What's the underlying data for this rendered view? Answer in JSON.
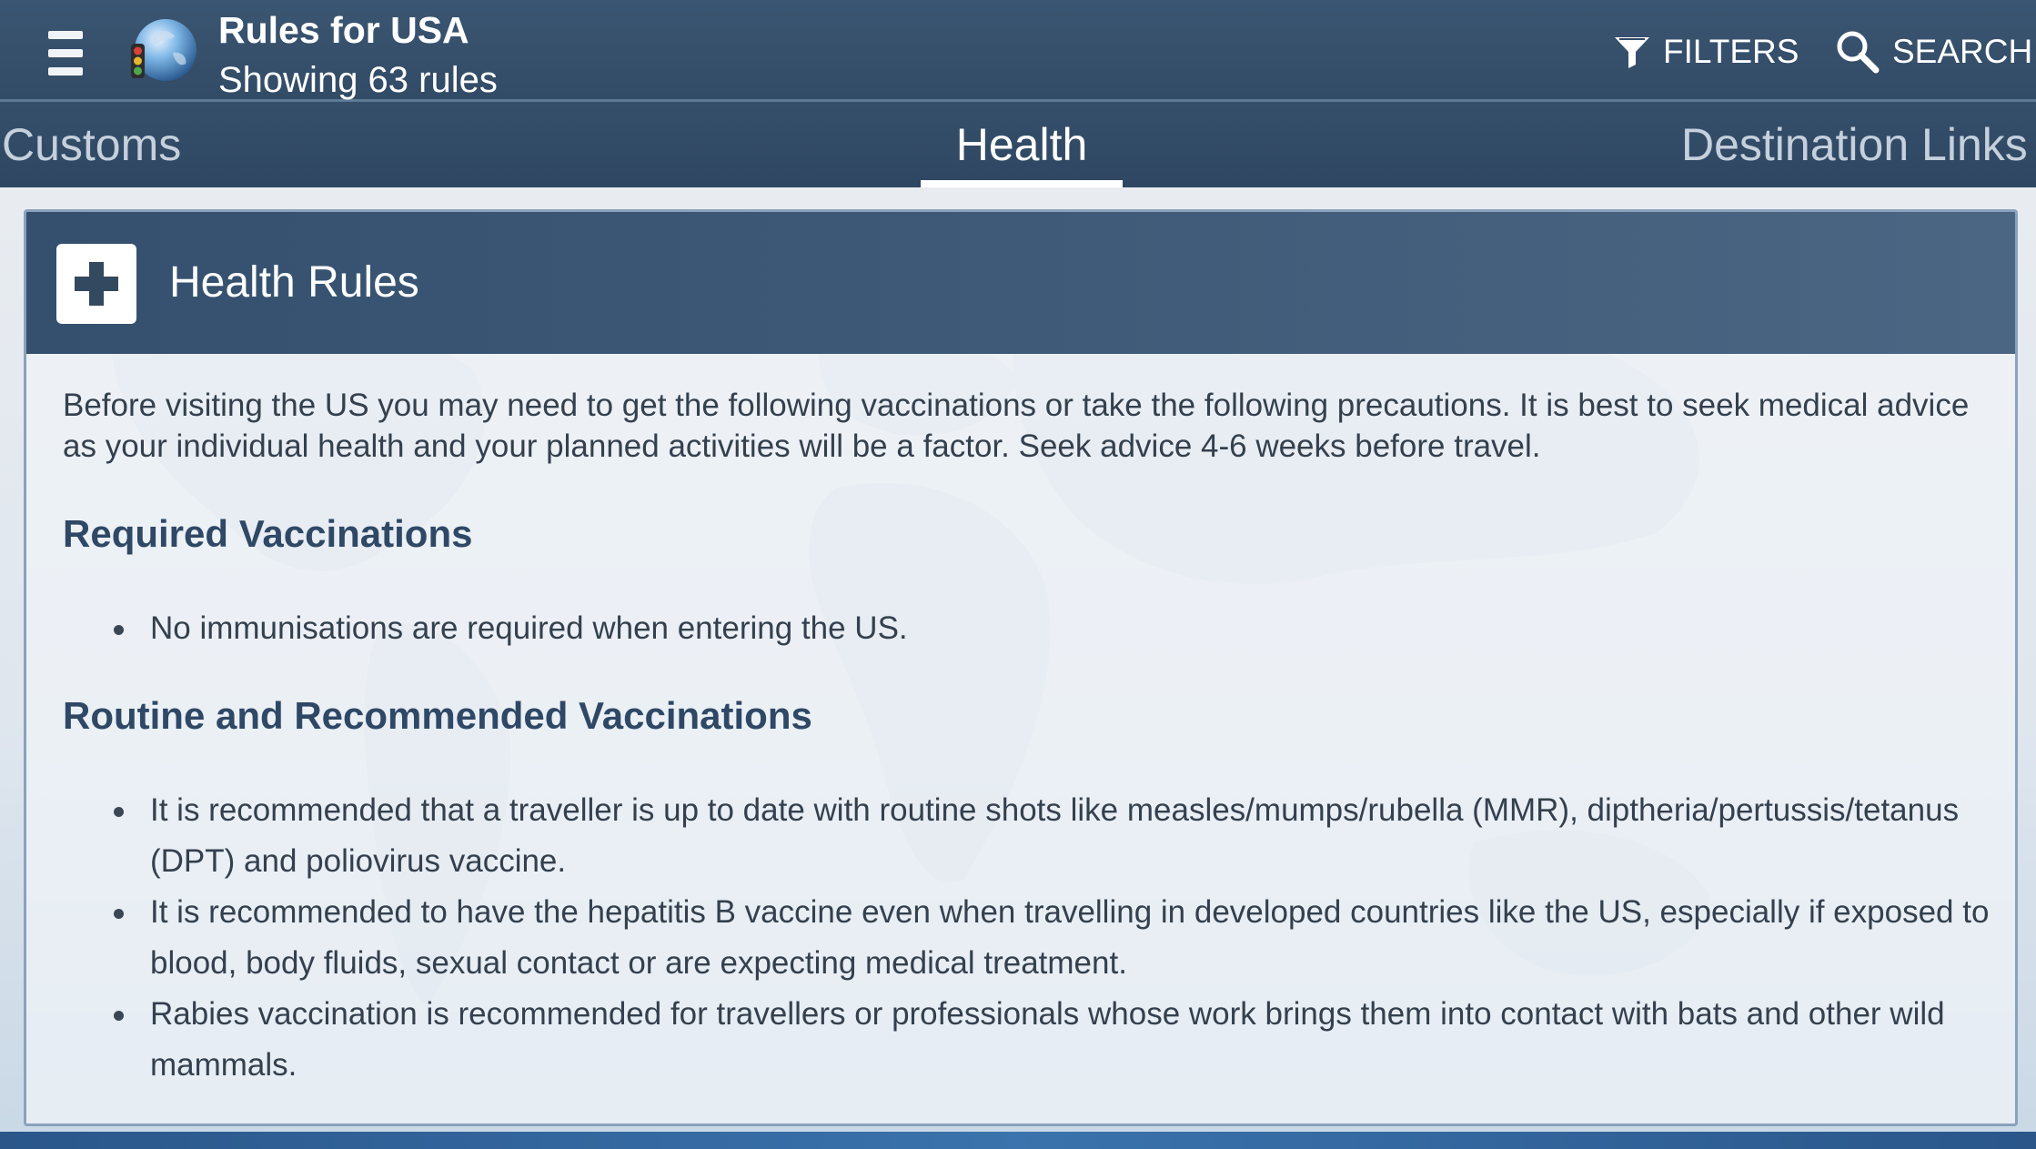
{
  "app_bar": {
    "title": "Rules for USA",
    "subtitle": "Showing 63 rules",
    "menu_icon": "hamburger-menu-icon",
    "logo_icon": "globe-traffic-light-icon",
    "actions": {
      "filters_label": "FILTERS",
      "filters_icon": "funnel-filter-icon",
      "search_label": "SEARCH",
      "search_icon": "magnifier-search-icon"
    }
  },
  "tabs": [
    {
      "label": "Customs",
      "active": false
    },
    {
      "label": "Health",
      "active": true
    },
    {
      "label": "Destination Links",
      "active": false
    }
  ],
  "card": {
    "icon": "medical-plus-icon",
    "title": "Health Rules",
    "intro": "Before visiting the US you may need to get the following vaccinations or take the following precautions. It is best to seek medical advice as your individual health and your planned activities will be a factor. Seek advice 4-6 weeks before travel.",
    "sections": [
      {
        "heading": "Required Vaccinations",
        "items": [
          "No immunisations are required when entering the US."
        ]
      },
      {
        "heading": "Routine and Recommended Vaccinations",
        "items": [
          "It is recommended that a traveller is up to date with routine shots like measles/mumps/rubella (MMR), diptheria/pertussis/tetanus (DPT) and poliovirus vaccine.",
          "It is recommended to have the hepatitis B vaccine even when travelling in developed countries like the US, especially if exposed to blood, body fluids, sexual contact or are expecting medical treatment.",
          "Rabies vaccination is recommended for travellers or professionals whose work brings them into contact with bats and other wild mammals."
        ]
      }
    ]
  },
  "colors": {
    "app_bar": "#34506e",
    "heading_text": "#2e4866",
    "body_text": "#34404d",
    "active_tab_indicator": "#ffffff"
  }
}
